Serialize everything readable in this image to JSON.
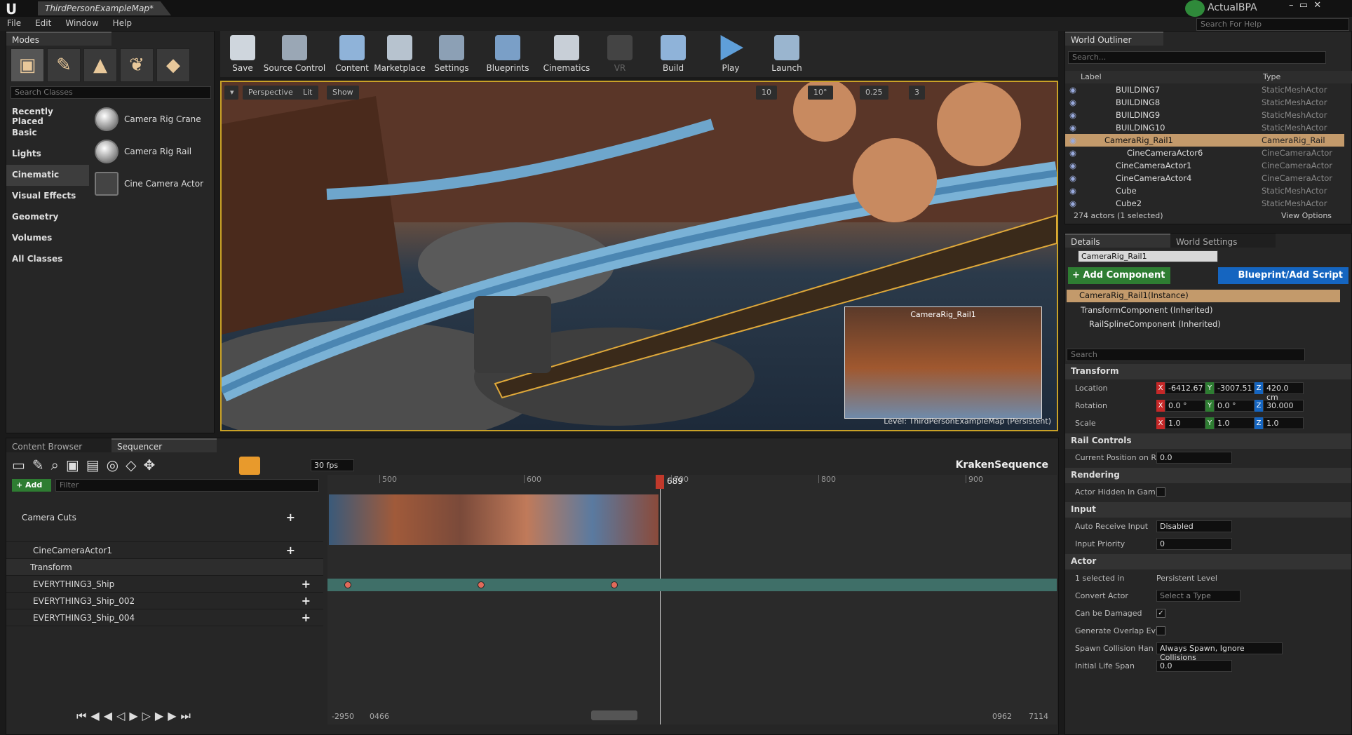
{
  "window": {
    "title": "ThirdPersonExampleMap*",
    "app_name": "ActualBPA",
    "search_help_placeholder": "Search For Help"
  },
  "menu": [
    "File",
    "Edit",
    "Window",
    "Help"
  ],
  "modes": {
    "tab": "Modes",
    "search_placeholder": "Search Classes",
    "categories": [
      "Recently Placed",
      "Basic",
      "Lights",
      "Cinematic",
      "Visual Effects",
      "Geometry",
      "Volumes",
      "All Classes"
    ],
    "selected_category": "Cinematic",
    "items": [
      "Camera Rig Crane",
      "Camera Rig Rail",
      "Cine Camera Actor"
    ]
  },
  "toolbar": {
    "buttons": [
      "Save",
      "Source Control",
      "Content",
      "Marketplace",
      "Settings",
      "Blueprints",
      "Cinematics",
      "VR",
      "Build",
      "Play",
      "Launch"
    ]
  },
  "viewport": {
    "perspective": "Perspective",
    "lit": "Lit",
    "show": "Show",
    "grid_snap": "10",
    "rot_snap": "10°",
    "scale_snap": "0.25",
    "camera_speed": "3",
    "pip_label": "CameraRig_Rail1",
    "level_label": "Level:  ThirdPersonExampleMap (Persistent)"
  },
  "outliner": {
    "tab": "World Outliner",
    "search_placeholder": "Search...",
    "col_label": "Label",
    "col_type": "Type",
    "rows": [
      {
        "label": "BUILDING7",
        "type": "StaticMeshActor"
      },
      {
        "label": "BUILDING8",
        "type": "StaticMeshActor"
      },
      {
        "label": "BUILDING9",
        "type": "StaticMeshActor"
      },
      {
        "label": "BUILDING10",
        "type": "StaticMeshActor"
      },
      {
        "label": "CameraRig_Rail1",
        "type": "CameraRig_Rail"
      },
      {
        "label": "CineCameraActor6",
        "type": "CineCameraActor"
      },
      {
        "label": "CineCameraActor1",
        "type": "CineCameraActor"
      },
      {
        "label": "CineCameraActor4",
        "type": "CineCameraActor"
      },
      {
        "label": "Cube",
        "type": "StaticMeshActor"
      },
      {
        "label": "Cube2",
        "type": "StaticMeshActor"
      }
    ],
    "footer": "274 actors (1 selected)",
    "view_options": "View Options"
  },
  "details": {
    "tab": "Details",
    "tab2": "World Settings",
    "name": "CameraRig_Rail1",
    "add_component": "+ Add Component",
    "blueprint_script": "Blueprint/Add Script",
    "instance": "CameraRig_Rail1(Instance)",
    "components": [
      "TransformComponent (Inherited)",
      "RailSplineComponent (Inherited)"
    ],
    "search_placeholder": "Search",
    "transform": {
      "title": "Transform",
      "location": "Location",
      "rotation": "Rotation",
      "scale": "Scale",
      "loc": [
        "-6412.67",
        "-3007.51",
        "420.0 cm"
      ],
      "rot": [
        "0.0 °",
        "0.0 °",
        "30.000"
      ],
      "scl": [
        "1.0",
        "1.0",
        "1.0"
      ]
    },
    "rail": {
      "title": "Rail Controls",
      "pos_label": "Current Position on R",
      "pos": "0.0"
    },
    "rendering": {
      "title": "Rendering",
      "hidden_label": "Actor Hidden In Gam"
    },
    "input": {
      "title": "Input",
      "auto_label": "Auto Receive Input",
      "auto": "Disabled",
      "prio_label": "Input Priority",
      "prio": "0"
    },
    "actor": {
      "title": "Actor",
      "sel_label": "1 selected in",
      "sel": "Persistent Level",
      "convert_label": "Convert Actor",
      "convert": "Select a Type",
      "dmg_label": "Can be Damaged",
      "overlap_label": "Generate Overlap Ev",
      "spawn_label": "Spawn Collision Han",
      "spawn": "Always Spawn, Ignore Collisions",
      "life_label": "Initial Life Span",
      "life": "0.0"
    }
  },
  "sequencer": {
    "tab_cb": "Content Browser",
    "tab_seq": "Sequencer",
    "fps": "30 fps",
    "sequence_name": "KrakenSequence",
    "add": "+ Add",
    "filter_placeholder": "Filter",
    "playhead": "689",
    "ticks": [
      "500",
      "600",
      "700",
      "800",
      "900"
    ],
    "tracks": [
      "Camera Cuts",
      "CineCameraActor1",
      "Transform",
      "EVERYTHING3_Ship",
      "EVERYTHING3_Ship_002",
      "EVERYTHING3_Ship_004"
    ],
    "range": {
      "start": "-2950",
      "in": "0466",
      "out": "0962",
      "end": "7114"
    }
  }
}
